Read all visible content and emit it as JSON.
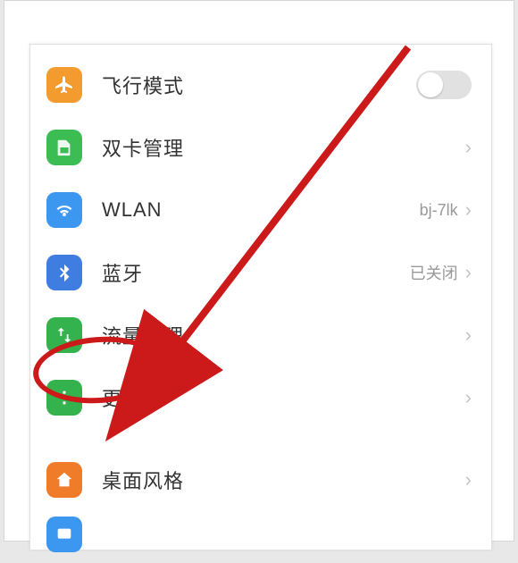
{
  "statusbar": "",
  "settings": {
    "airplane": {
      "label": "飞行模式",
      "icon": "airplane-icon",
      "color": "#f39b2e"
    },
    "dualsim": {
      "label": "双卡管理",
      "icon": "sim-icon",
      "color": "#3bbd54"
    },
    "wlan": {
      "label": "WLAN",
      "icon": "wifi-icon",
      "color": "#3c97f0",
      "value": "bj-7lk"
    },
    "bluetooth": {
      "label": "蓝牙",
      "icon": "bluetooth-icon",
      "color": "#3f7de0",
      "value": "已关闭"
    },
    "traffic": {
      "label": "流量管理",
      "icon": "traffic-icon",
      "color": "#34b24e"
    },
    "more": {
      "label": "更多",
      "icon": "more-icon",
      "color": "#34b24e"
    },
    "homestyle": {
      "label": "桌面风格",
      "icon": "home-icon",
      "color": "#f07b28"
    },
    "display": {
      "label": "",
      "icon": "display-icon",
      "color": "#3c97f0"
    }
  },
  "annotation": {
    "highlighted_item": "more"
  }
}
